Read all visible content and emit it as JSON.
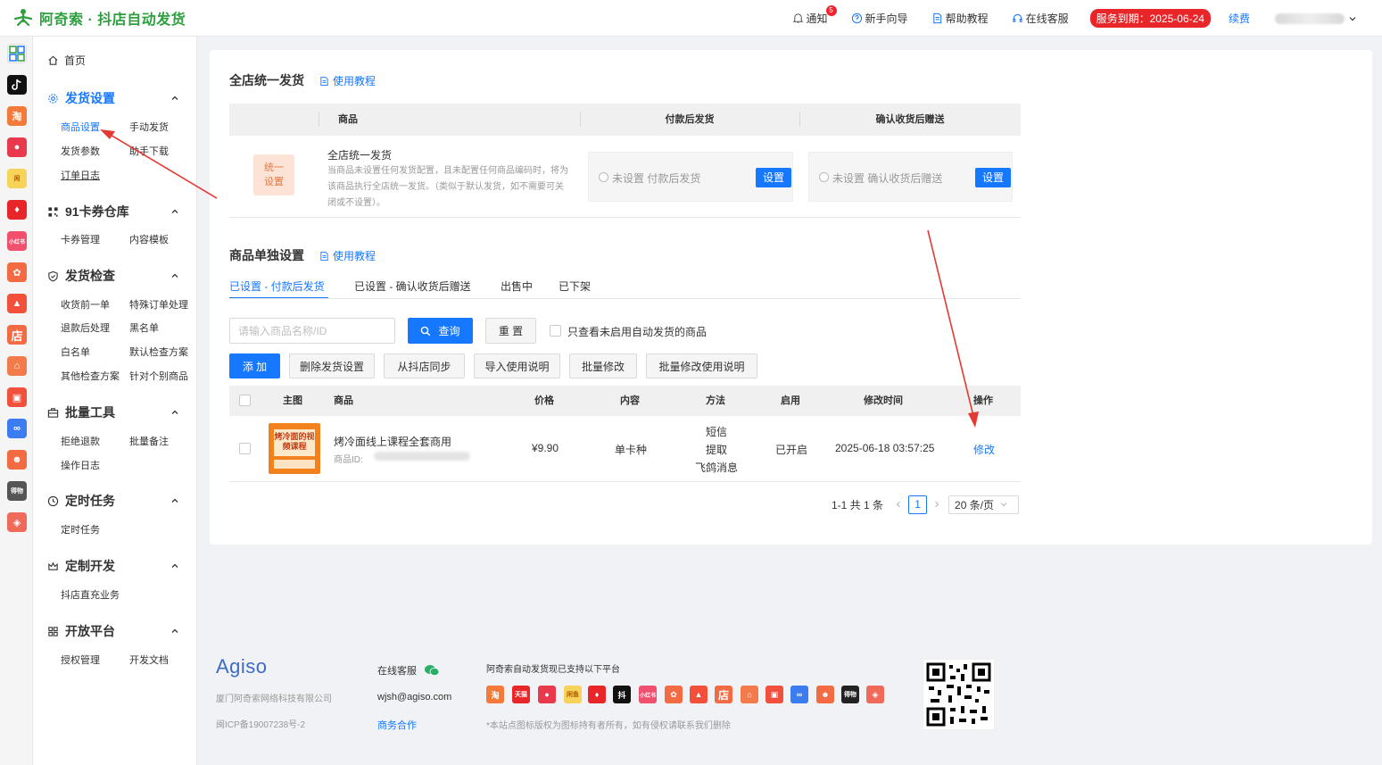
{
  "header": {
    "brand": "阿奇索 · 抖店自动发货",
    "notice": "通知",
    "notice_count": "5",
    "guide": "新手向导",
    "help": "帮助教程",
    "support": "在线客服",
    "service_expiry": "服务到期：2025-06-24",
    "renew": "续费"
  },
  "sidebar": {
    "home": "首页",
    "sections": [
      {
        "title": "发货设置",
        "items": [
          "商品设置",
          "手动发货",
          "发货参数",
          "助手下载",
          "订单日志"
        ]
      },
      {
        "title": "91卡券仓库",
        "items": [
          "卡券管理",
          "内容模板"
        ]
      },
      {
        "title": "发货检查",
        "items": [
          "收货前一单",
          "特殊订单处理",
          "退款后处理",
          "黑名单",
          "白名单",
          "默认检查方案",
          "其他检查方案",
          "针对个别商品"
        ]
      },
      {
        "title": "批量工具",
        "items": [
          "拒绝退款",
          "批量备注",
          "操作日志"
        ]
      },
      {
        "title": "定时任务",
        "items": [
          "定时任务"
        ]
      },
      {
        "title": "定制开发",
        "items": [
          "抖店直充业务"
        ]
      },
      {
        "title": "开放平台",
        "items": [
          "授权管理",
          "开发文档"
        ]
      }
    ]
  },
  "platform_icons": [
    "淘",
    "抖",
    "店",
    "小红书",
    "拼多多",
    "京东",
    "快手",
    "微店",
    "有赞",
    "钉钉",
    "饿了么",
    "微信",
    "支付宝"
  ],
  "unified": {
    "title": "全店统一发货",
    "tutorial": "使用教程",
    "columns": [
      "商品",
      "付款后发货",
      "确认收货后赠送"
    ],
    "tag": "统一设置",
    "tag_l1": "统一",
    "tag_l2": "设置",
    "row_title": "全店统一发货",
    "row_desc": "当商品未设置任何发货配置，且未配置任何商品编码时，将为该商品执行全店统一发货。（类似于默认发货，如不需要可关闭或不设置）。",
    "pay_label": "未设置 付款后发货",
    "confirm_label": "未设置 确认收货后赠送",
    "set_button": "设置"
  },
  "single": {
    "title": "商品单独设置",
    "tutorial": "使用教程",
    "tabs": [
      "已设置 - 付款后发货",
      "已设置 - 确认收货后赠送",
      "出售中",
      "已下架"
    ],
    "search_placeholder": "请输入商品名称/ID",
    "query": "查询",
    "reset": "重 置",
    "only_unenabled": "只查看未启用自动发货的商品",
    "actions": [
      "添 加",
      "删除发货设置",
      "从抖店同步",
      "导入使用说明",
      "批量修改",
      "批量修改使用说明"
    ],
    "columns": [
      "主图",
      "商品",
      "价格",
      "内容",
      "方法",
      "启用",
      "修改时间",
      "操作"
    ],
    "rows": [
      {
        "thumb_text": "烤冷面的视频课程",
        "name": "烤冷面线上课程全套商用",
        "id_label": "商品ID:",
        "price": "¥9.90",
        "content": "单卡种",
        "methods": [
          "短信",
          "提取",
          "飞鸽消息"
        ],
        "enabled": "已开启",
        "modified": "2025-06-18 03:57:25",
        "action": "修改"
      }
    ],
    "pagination": {
      "summary": "1-1 共 1 条",
      "page": "1",
      "page_size": "20 条/页"
    }
  },
  "footer": {
    "brand": "Agiso",
    "company": "厦门阿奇索网络科技有限公司",
    "icp": "闽ICP备19007238号-2",
    "support": "在线客服",
    "email": "wjsh@agiso.com",
    "business": "商务合作",
    "platforms_title": "阿奇索自动发货现已支持以下平台",
    "disclaimer": "*本站点图标版权为图标持有者所有，如有侵权请联系我们删除",
    "platform_icons": [
      "淘",
      "天猫",
      "拼多多",
      "闲鱼",
      "京东",
      "抖",
      "小红书",
      "美团",
      "快手",
      "店",
      "微店",
      "有赞",
      "支付宝",
      "饿了么",
      "得物",
      "快"
    ]
  },
  "colors": {
    "primary": "#1677ff",
    "brand_green": "#2e9e3f",
    "danger": "#e8262a"
  }
}
